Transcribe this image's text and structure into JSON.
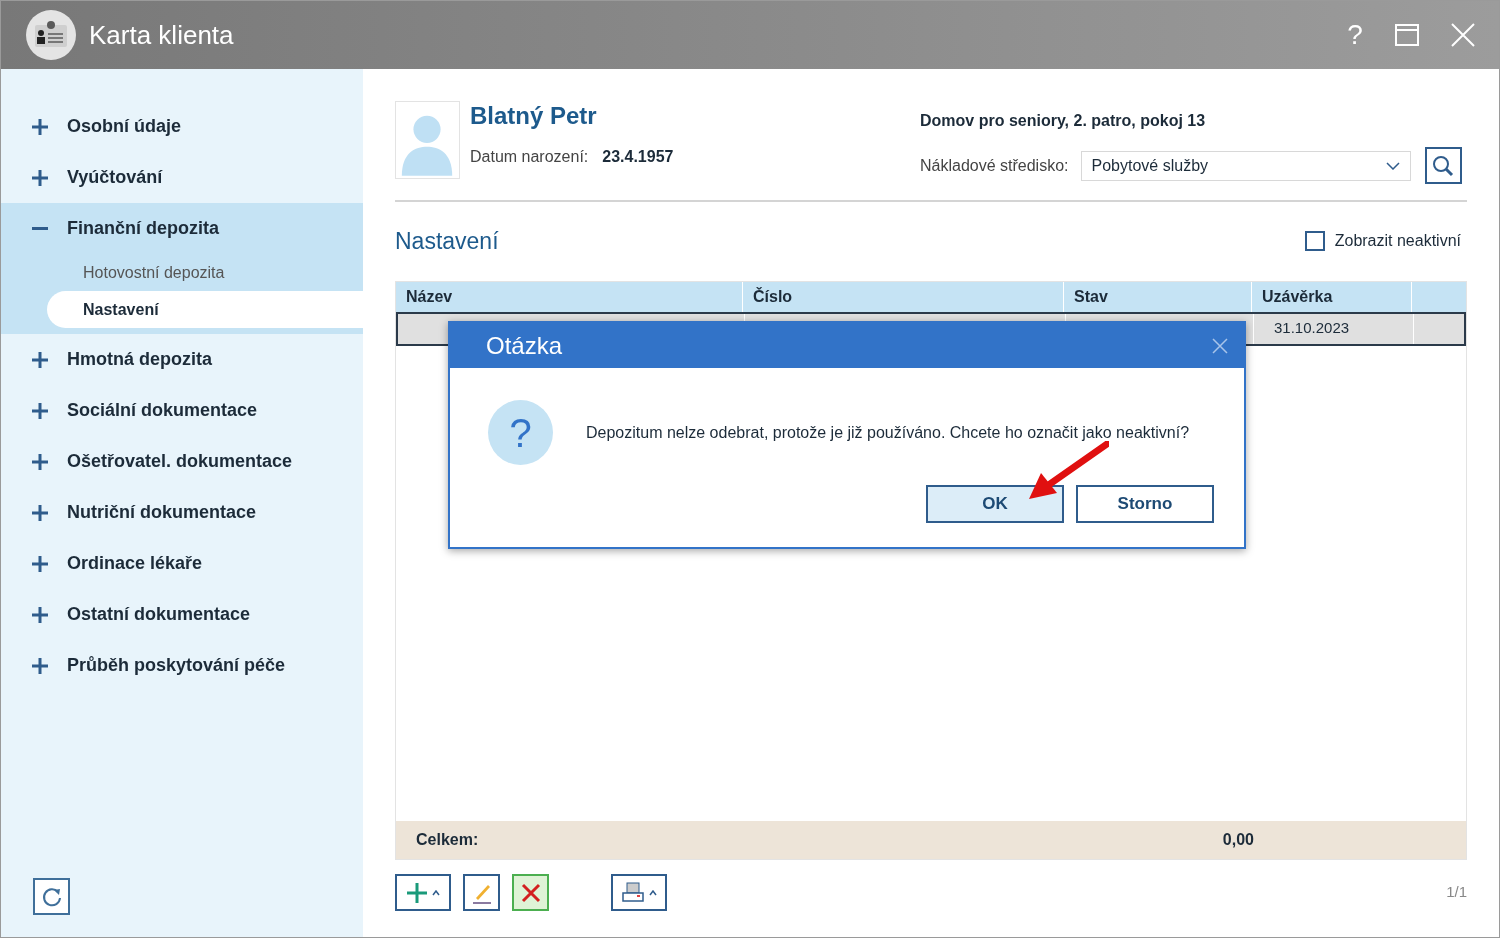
{
  "window": {
    "title": "Karta klienta",
    "buttons": [
      "?"
    ]
  },
  "sidebar": {
    "items": [
      {
        "label": "Osobní údaje",
        "expanded": false
      },
      {
        "label": "Vyúčtování",
        "expanded": false
      },
      {
        "label": "Finanční depozita",
        "expanded": true,
        "children": [
          {
            "label": "Hotovostní depozita",
            "selected": false
          },
          {
            "label": "Nastavení",
            "selected": true
          }
        ]
      },
      {
        "label": "Hmotná depozita",
        "expanded": false
      },
      {
        "label": "Sociální dokumentace",
        "expanded": false
      },
      {
        "label": "Ošetřovatel. dokumentace",
        "expanded": false
      },
      {
        "label": "Nutriční dokumentace",
        "expanded": false
      },
      {
        "label": "Ordinace lékaře",
        "expanded": false
      },
      {
        "label": "Ostatní dokumentace",
        "expanded": false
      },
      {
        "label": "Průběh poskytování péče",
        "expanded": false
      }
    ]
  },
  "client": {
    "name": "Blatný Petr",
    "birth_label": "Datum narození:",
    "birth_date": "23.4.1957",
    "location": "Domov pro seniory, 2. patro, pokoj 13",
    "cost_center_label": "Nákladové středisko:",
    "cost_center": "Pobytové služby"
  },
  "section": {
    "title": "Nastavení",
    "show_inactive": {
      "label": "Zobrazit neaktivní",
      "checked": false
    }
  },
  "table": {
    "columns": [
      "Název",
      "Číslo",
      "Stav",
      "Uzávěrka"
    ],
    "rows": [
      {
        "column_4": "31.10.2023",
        "selected": true
      }
    ],
    "total_label": "Celkem:",
    "total": "0,00"
  },
  "pager": "1/1",
  "dialog": {
    "title": "Otázka",
    "icon": "?",
    "message": "Depozitum nelze odebrat, protože je již používáno. Chcete ho označit jako neaktivní?",
    "buttons": [
      {
        "label": "OK",
        "selected": true
      },
      {
        "label": "Storno",
        "selected": false
      }
    ]
  }
}
